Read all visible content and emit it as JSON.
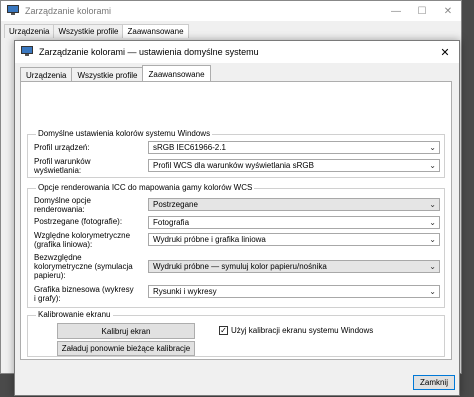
{
  "back_window": {
    "title": "Zarządzanie kolorami",
    "tabs": [
      "Urządzenia",
      "Wszystkie profile",
      "Zaawansowane"
    ]
  },
  "window": {
    "title": "Zarządzanie kolorami — ustawienia domyślne systemu",
    "tabs": [
      "Urządzenia",
      "Wszystkie profile",
      "Zaawansowane"
    ],
    "active_tab": "Zaawansowane"
  },
  "defaults": {
    "legend": "Domyślne ustawienia kolorów systemu Windows",
    "device_profile_label": "Profil urządzeń:",
    "device_profile_value": "sRGB IEC61966-2.1",
    "viewing_profile_label": "Profil warunków wyświetlania:",
    "viewing_profile_value": "Profil WCS dla warunków wyświetlania sRGB"
  },
  "rendering": {
    "legend": "Opcje renderowania ICC do mapowania gamy kolorów WCS",
    "rows": [
      {
        "label": "Domyślne opcje renderowania:",
        "value": "Postrzegane",
        "gray": true
      },
      {
        "label": "Postrzegane (fotografie):",
        "value": "Fotografia",
        "gray": false
      },
      {
        "label": "Względne kolorymetryczne (grafika liniowa):",
        "value": "Wydruki próbne i grafika liniowa",
        "gray": false
      },
      {
        "label": "Bezwzględne kolorymetryczne (symulacja papieru):",
        "value": "Wydruki próbne — symuluj kolor papieru/nośnika",
        "gray": true
      },
      {
        "label": "Grafika biznesowa (wykresy i grafy):",
        "value": "Rysunki i wykresy",
        "gray": false
      }
    ]
  },
  "calibration": {
    "legend": "Kalibrowanie ekranu",
    "calibrate_button": "Kalibruj ekran",
    "reload_button": "Załaduj ponownie bieżące kalibracje",
    "use_calibration_label": "Użyj kalibracji ekranu systemu Windows",
    "use_calibration_checked": true
  },
  "close_button": "Zamknij"
}
